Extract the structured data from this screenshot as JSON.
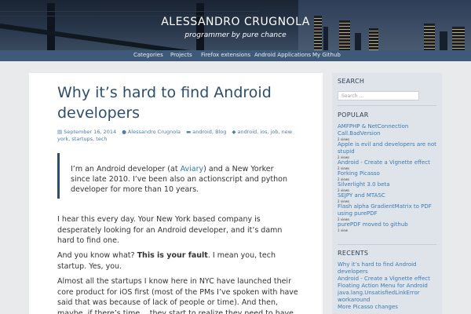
{
  "site": {
    "title": "ALESSANDRO CRUGNOLA",
    "description": "programmer by pure chance"
  },
  "nav": {
    "items": [
      "Categories",
      "Projects",
      "Firefox extensions",
      "Android Applications",
      "My Github"
    ]
  },
  "post": {
    "title": "Why it’s hard to find Android developers",
    "date": "September 16, 2014",
    "author": "Alessandro Crugnola",
    "categories": "android, Blog",
    "tags": "android, ios, job, new york, startups, tech",
    "quote_before_link": "I’m an Android developer (at ",
    "quote_link": "Aviary",
    "quote_after_link": ") and a New Yorker since late 2010. I’ve been also an actionscript and python developer for more than 10 years.",
    "para1": "I hear this every day. Your New York based company is desperately looking for an Android developer, and it’s damn hard to find one.",
    "para2_before": "And you know what? ",
    "para2_bold": "This is your fault",
    "para2_after": ". I mean you, tech startup. Yes, you.",
    "para3": "Almost all the startups I know here in NYC have launched their core product for iOS first (most of the PMs I’ve spoken with have said that was because of lack of people or time). And then, maybe, if there’s time… they start to realize they need to have an Android version of"
  },
  "sidebar": {
    "search": {
      "title": "SEARCH",
      "placeholder": "Search …"
    },
    "popular": {
      "title": "POPULAR",
      "items": [
        {
          "label": "AMFPHP & NetConnection Call.BadVersion",
          "views": "2 views"
        },
        {
          "label": "Apple is evil and developers are not stupid",
          "views": "2 views"
        },
        {
          "label": "Android - Create a Vignette effect",
          "views": "2 views"
        },
        {
          "label": "Forking Picasso",
          "views": "2 views"
        },
        {
          "label": "Silverlight 3.0 beta",
          "views": "2 views"
        },
        {
          "label": "SEJPY and MTASC",
          "views": "2 views"
        },
        {
          "label": "Flash alpha GradientMatrix to PDF using purePDF",
          "views": "2 views"
        },
        {
          "label": "purePDF moved to github",
          "views": "1 view"
        }
      ]
    },
    "recents": {
      "title": "RECENTS",
      "items": [
        "Why it’s hard to find Android developers",
        "Android - Create a Vignette effect",
        "Floating Action Menu for Android",
        "java.lang.UnsatisfiedLinkError workaround",
        "More Picasso changes"
      ]
    }
  }
}
